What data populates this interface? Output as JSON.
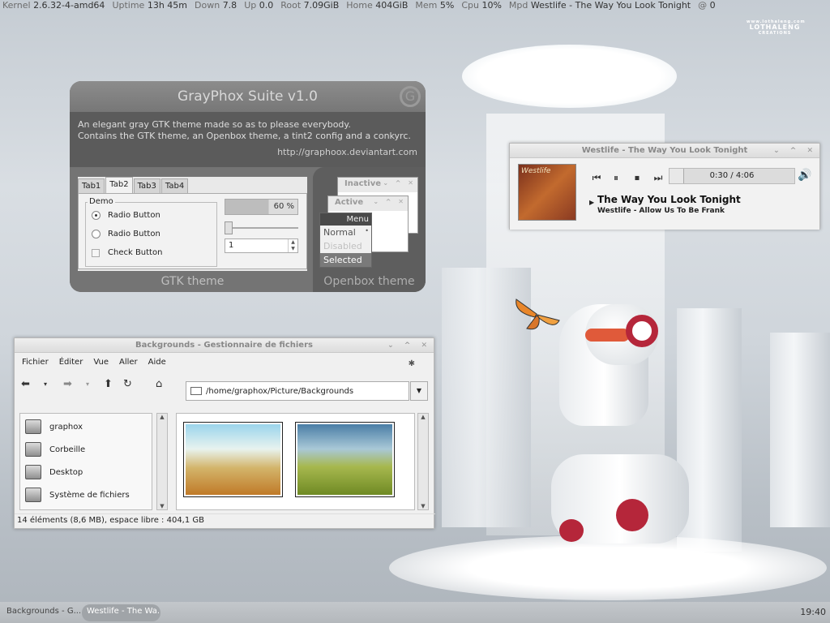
{
  "conky": [
    {
      "k": "Kernel",
      "v": "2.6.32-4-amd64"
    },
    {
      "k": "Uptime",
      "v": "13h 45m"
    },
    {
      "k": "Down",
      "v": "7.8"
    },
    {
      "k": "Up",
      "v": "0.0"
    },
    {
      "k": "Root",
      "v": "7.09GiB"
    },
    {
      "k": "Home",
      "v": "404GiB"
    },
    {
      "k": "Mem",
      "v": "5%"
    },
    {
      "k": "Cpu",
      "v": "10%"
    },
    {
      "k": "Mpd",
      "v": "Westlife - The Way You Look Tonight"
    },
    {
      "k": "@",
      "v": "0"
    }
  ],
  "logo": {
    "line1": "www.lothaleng.com",
    "line2": "LOTHALENG",
    "line3": "CREATIONS"
  },
  "grayphox": {
    "title": "GrayPhox Suite v1.0",
    "desc_line1": "An elegant gray GTK theme made so as to please everybody.",
    "desc_line2": "Contains the GTK theme, an Openbox theme, a tint2 config and a conkyrc.",
    "url": "http://graphoox.deviantart.com",
    "tabs": [
      "Tab1",
      "Tab2",
      "Tab3",
      "Tab4"
    ],
    "demo_label": "Demo",
    "radio1": "Radio Button",
    "radio2": "Radio Button",
    "check": "Check Button",
    "progress": "60 %",
    "progress_value": 0.6,
    "spin": "1",
    "gtk_label": "GTK theme",
    "ob_inactive": "Inactive",
    "ob_active": "Active",
    "menu_header": "Menu",
    "menu_normal": "Normal",
    "menu_disabled": "Disabled",
    "menu_selected": "Selected",
    "ob_label": "Openbox theme"
  },
  "player": {
    "title": "Westlife - The Way You Look Tonight",
    "time": "0:30 / 4:06",
    "progress_value": 0.12,
    "song": "The Way You Look Tonight",
    "artist_album": "Westlife - Allow Us To Be Frank",
    "cover_text": "Westlife"
  },
  "fm": {
    "title": "Backgrounds - Gestionnaire de fichiers",
    "menu": [
      "Fichier",
      "Éditer",
      "Vue",
      "Aller",
      "Aide"
    ],
    "path": "/home/graphox/Picture/Backgrounds",
    "places": [
      "graphox",
      "Corbeille",
      "Desktop",
      "Système de fichiers"
    ],
    "status": "14 éléments (8,6 MB), espace libre : 404,1 GB"
  },
  "taskbar": {
    "tasks": [
      "Backgrounds - G...",
      "Westlife - The Wa..."
    ],
    "clock": "19:40"
  }
}
